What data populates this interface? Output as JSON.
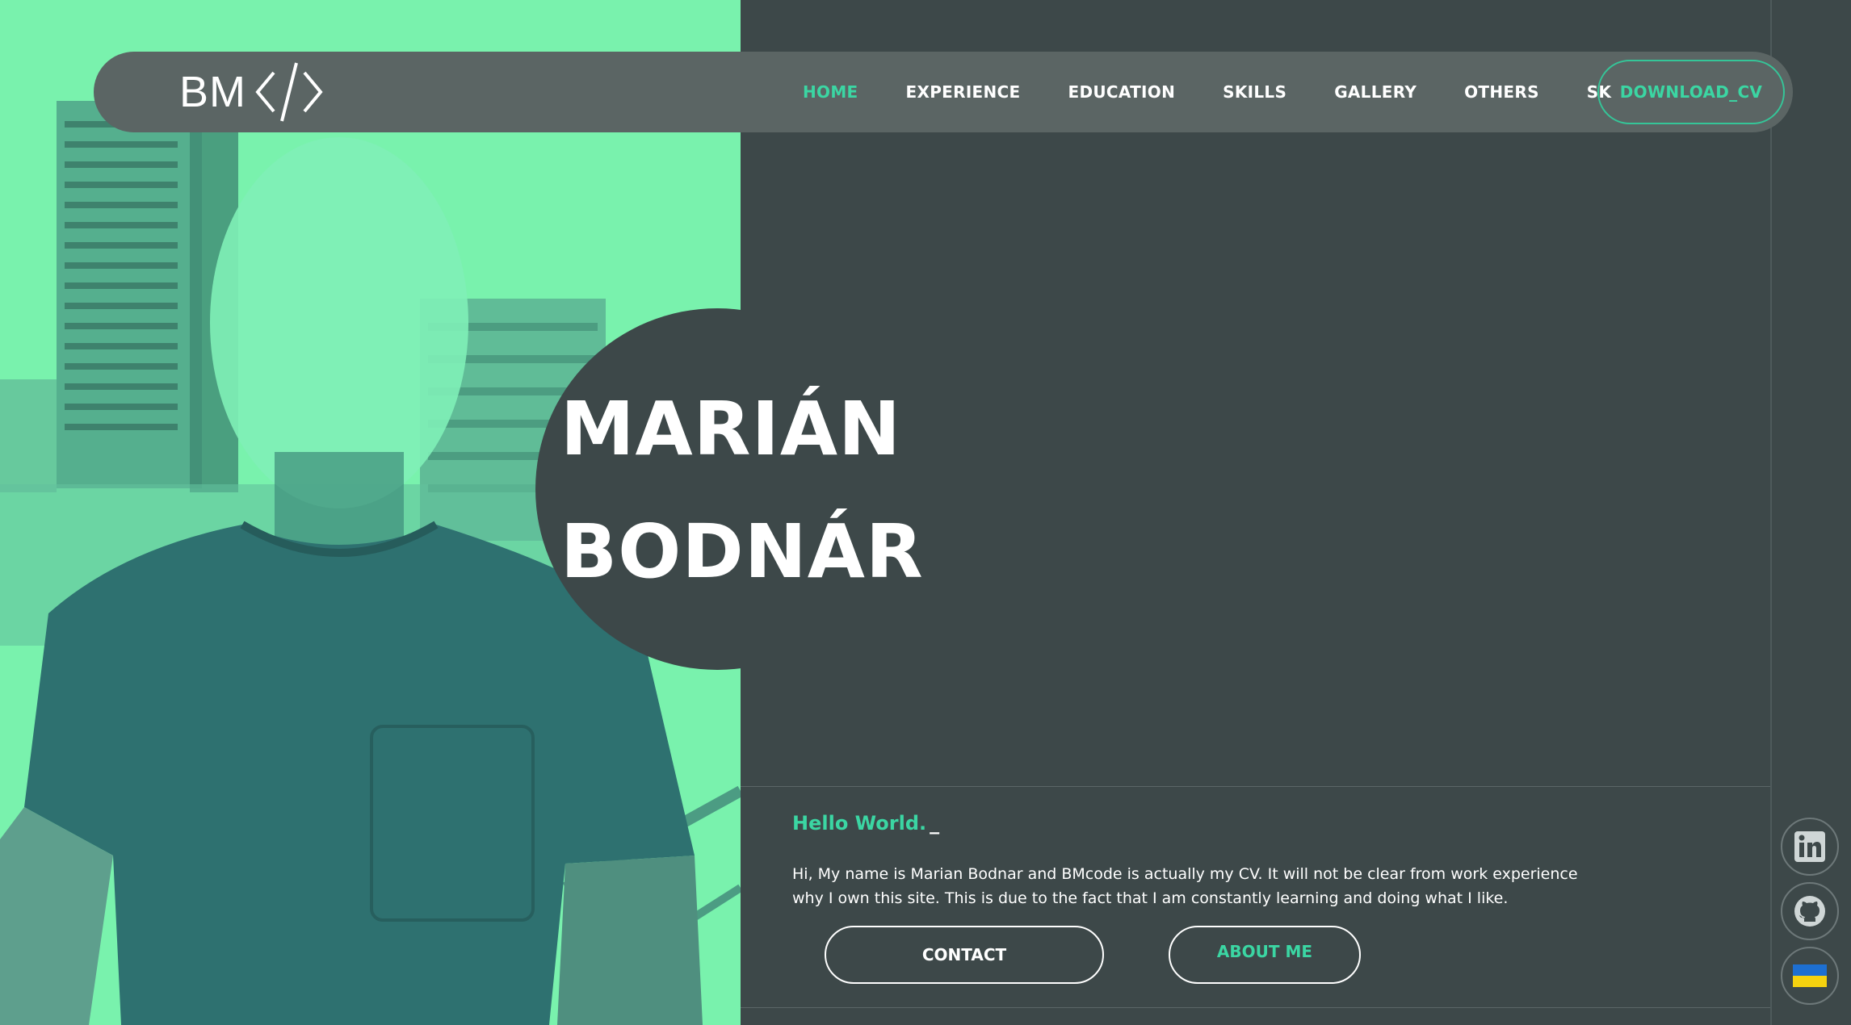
{
  "logo": {
    "text": "BM",
    "icon": "code-brackets-icon"
  },
  "nav": {
    "items": [
      {
        "label": "HOME",
        "active": true
      },
      {
        "label": "EXPERIENCE",
        "active": false
      },
      {
        "label": "EDUCATION",
        "active": false
      },
      {
        "label": "SKILLS",
        "active": false
      },
      {
        "label": "GALLERY",
        "active": false
      },
      {
        "label": "OTHERS",
        "active": false
      },
      {
        "label": "SK",
        "active": false
      }
    ],
    "download_label": "DOWNLOAD_CV"
  },
  "hero": {
    "first_name": "MARIÁN",
    "last_name": "BODNÁR"
  },
  "intro": {
    "greeting": "Hello World.",
    "cursor": "_",
    "text": "Hi, My name is Marian Bodnar and BMcode is actually my CV. It will not be clear from work experience why I own this site. This is due to the fact that I am constantly learning and doing what I like.",
    "contact_label": "CONTACT",
    "about_label": "ABOUT ME"
  },
  "social": [
    {
      "icon": "linkedin-icon"
    },
    {
      "icon": "github-icon"
    },
    {
      "icon": "ukraine-flag-icon"
    }
  ],
  "colors": {
    "accent": "#3bd6a3",
    "background": "#3d4849",
    "navbar": "#5b6564",
    "photo_tint": "#79f2ad"
  }
}
